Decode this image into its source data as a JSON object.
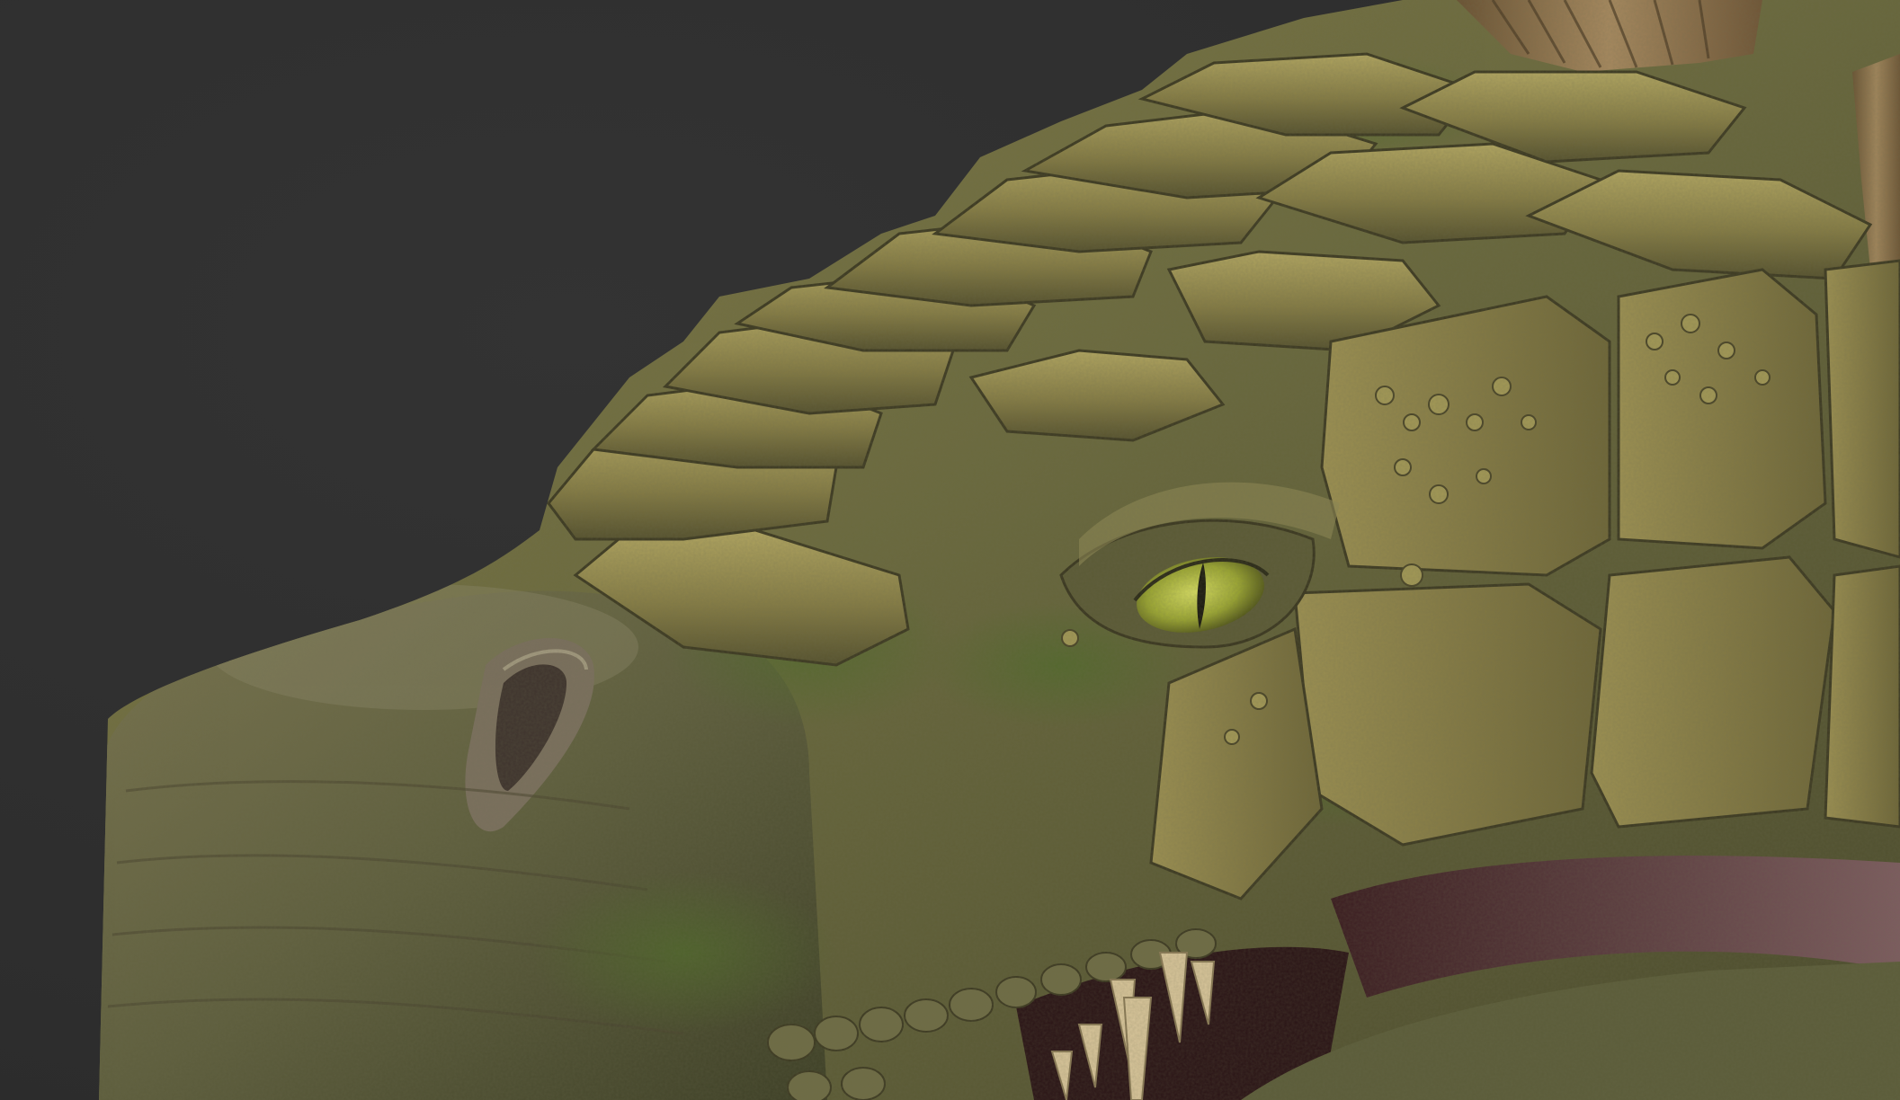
{
  "scene": {
    "subject": "dragon-head-sculpt",
    "colors": {
      "background": "#2f2f2f",
      "skin_base": "#6e6a3f",
      "skin_light": "#a49a5a",
      "skin_dark": "#3f3b24",
      "moss": "#56672e",
      "crease": "#6d5a5a",
      "eye": "#a7b23a",
      "pupil": "#1b1a10",
      "gum": "#6a4046",
      "tooth": "#d8c59a",
      "frill": "#8a6e4a"
    }
  }
}
